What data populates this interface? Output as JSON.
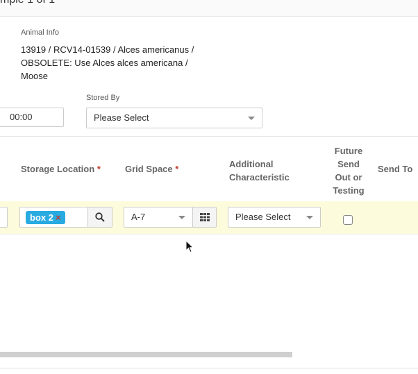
{
  "header": {
    "title": "mple 1 of 1"
  },
  "animal_info": {
    "label": "Animal Info",
    "line1": "13919 / RCV14-01539 / Alces americanus /",
    "line2": "OBSOLETE: Use Alces alces americana /",
    "line3": "Moose"
  },
  "time_field": {
    "value": "00:00"
  },
  "stored_by": {
    "label": "Stored By",
    "value": "Please Select"
  },
  "columns": {
    "storage_location": "Storage Location",
    "grid_space": "Grid Space",
    "additional_characteristic_line1": "Additional",
    "additional_characteristic_line2": "Characteristic",
    "future_line1": "Future",
    "future_line2": "Send",
    "future_line3": "Out or",
    "future_line4": "Testing",
    "send_to": "Send To",
    "required_mark": "*"
  },
  "row": {
    "storage_tag": "box 2",
    "tag_remove": "×",
    "grid_space_value": "A-7",
    "additional_characteristic_value": "Please Select"
  },
  "icons": {
    "search": "search-icon",
    "grid": "grid-icon",
    "remove": "close-icon",
    "caret": "chevron-down-icon",
    "cursor": "mouse-pointer-icon"
  },
  "colors": {
    "tag_bg": "#29abe2",
    "row_highlight": "#fcfcdc",
    "required": "#c0392b"
  }
}
